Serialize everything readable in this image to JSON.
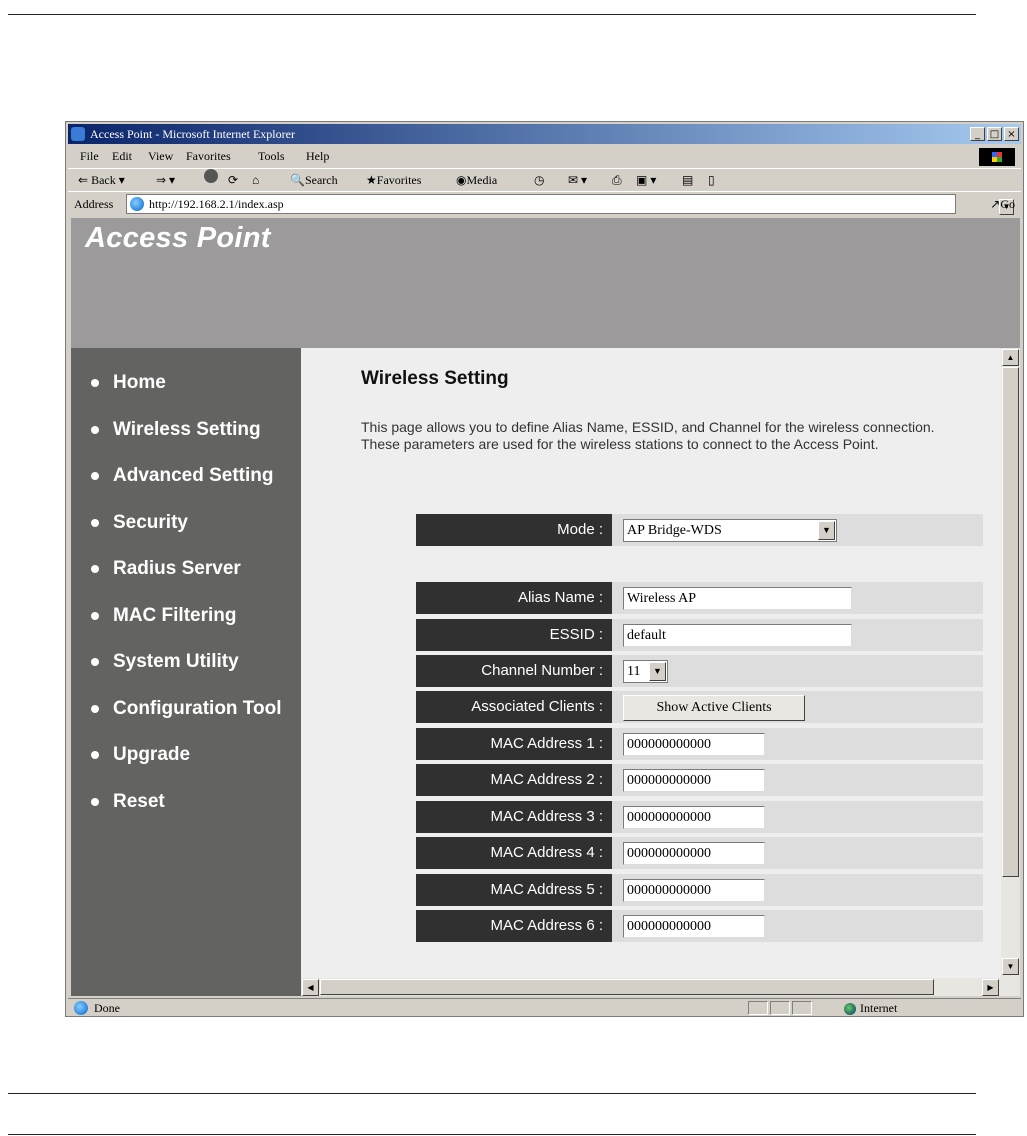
{
  "window": {
    "title": "Access Point - Microsoft Internet Explorer",
    "controls": {
      "minimize": "_",
      "maximize": "□",
      "close": "×"
    }
  },
  "menu": [
    "File",
    "Edit",
    "View",
    "Favorites",
    "Tools",
    "Help"
  ],
  "toolbar": {
    "back": "Back",
    "search": "Search",
    "favorites": "Favorites",
    "media": "Media"
  },
  "address": {
    "label": "Address",
    "url": "http://192.168.2.1/index.asp",
    "go": "Go"
  },
  "banner": {
    "brand": "Access Point"
  },
  "nav": [
    "Home",
    "Wireless Setting",
    "Advanced Setting",
    "Security",
    "Radius Server",
    "MAC Filtering",
    "System Utility",
    "Configuration Tool",
    "Upgrade",
    "Reset"
  ],
  "page": {
    "title": "Wireless Setting",
    "description": "This page allows you to define Alias Name, ESSID, and Channel for the wireless connection. These parameters are used for the wireless stations to connect to the Access Point."
  },
  "form": {
    "mode_label": "Mode :",
    "mode_value": "AP Bridge-WDS",
    "alias_label": "Alias Name :",
    "alias_value": "Wireless AP",
    "essid_label": "ESSID :",
    "essid_value": "default",
    "channel_label": "Channel Number :",
    "channel_value": "11",
    "clients_label": "Associated Clients :",
    "clients_button": "Show Active Clients",
    "mac": [
      {
        "label": "MAC Address 1 :",
        "value": "000000000000"
      },
      {
        "label": "MAC Address 2 :",
        "value": "000000000000"
      },
      {
        "label": "MAC Address 3 :",
        "value": "000000000000"
      },
      {
        "label": "MAC Address 4 :",
        "value": "000000000000"
      },
      {
        "label": "MAC Address 5 :",
        "value": "000000000000"
      },
      {
        "label": "MAC Address 6 :",
        "value": "000000000000"
      }
    ]
  },
  "status": {
    "text": "Done",
    "zone": "Internet"
  }
}
